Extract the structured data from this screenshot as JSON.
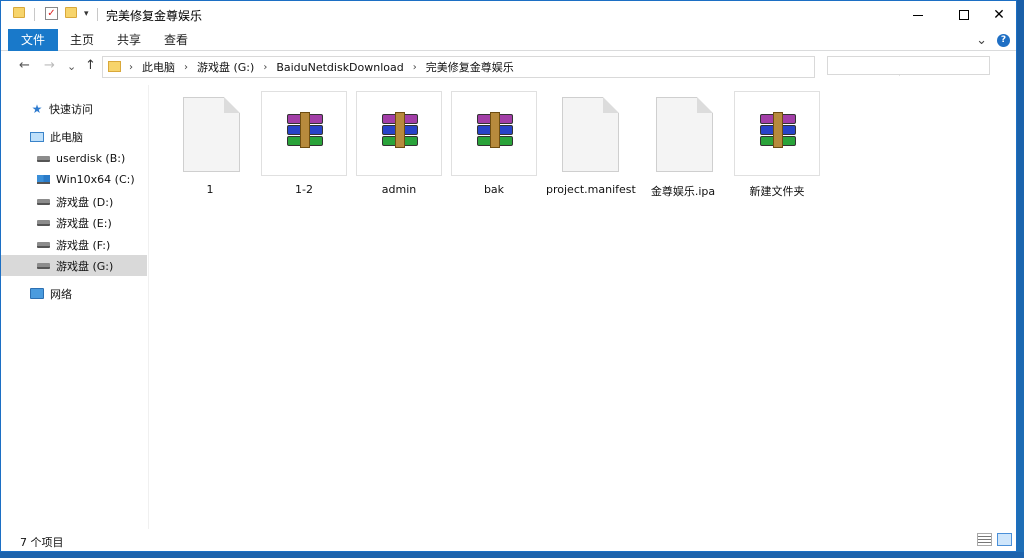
{
  "window": {
    "title": "完美修复金尊娱乐",
    "minimize_icon": "minimize-icon",
    "maximize_icon": "maximize-icon",
    "close_glyph": "✕"
  },
  "quick_access": {
    "check_glyph": "✓",
    "dropdown_glyph": "▾"
  },
  "ribbon": {
    "tabs": [
      "文件",
      "主页",
      "共享",
      "查看"
    ],
    "expand_glyph": "⌄",
    "help_glyph": "?"
  },
  "nav": {
    "back_glyph": "←",
    "forward_glyph": "→",
    "recent_glyph": "⌄",
    "up_glyph": "↑",
    "breadcrumb": [
      "此电脑",
      "游戏盘 (G:)",
      "BaiduNetdiskDownload",
      "完美修复金尊娱乐"
    ],
    "separator_glyph": "›",
    "dropdown_glyph": "⌄",
    "refresh_glyph": "↻",
    "search_placeholder": ""
  },
  "sidebar": {
    "quick_access_label": "快速访问",
    "this_pc_label": "此电脑",
    "drives": [
      {
        "label": "userdisk (B:)"
      },
      {
        "label": "Win10x64 (C:)"
      },
      {
        "label": "游戏盘 (D:)"
      },
      {
        "label": "游戏盘 (E:)"
      },
      {
        "label": "游戏盘 (F:)"
      },
      {
        "label": "游戏盘 (G:)",
        "selected": true
      }
    ],
    "network_label": "网络",
    "star_glyph": "★"
  },
  "files": [
    {
      "name": "1",
      "type": "file"
    },
    {
      "name": "1-2",
      "type": "rar"
    },
    {
      "name": "admin",
      "type": "rar"
    },
    {
      "name": "bak",
      "type": "rar"
    },
    {
      "name": "project.manifest",
      "type": "file"
    },
    {
      "name": "金尊娱乐.ipa",
      "type": "file"
    },
    {
      "name": "新建文件夹",
      "type": "rar"
    }
  ],
  "status": {
    "item_count": "7 个项目"
  },
  "colors": {
    "accent": "#1979ca",
    "selected_nav": "#d9d9d9",
    "folder": "#f7d46b"
  }
}
